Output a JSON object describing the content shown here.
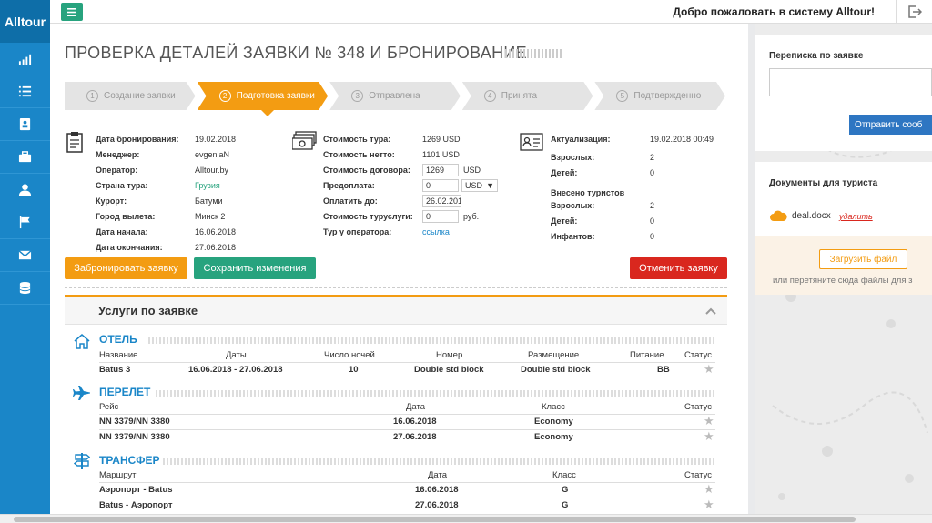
{
  "app": {
    "logo": "Alltour",
    "welcome": "Добро пожаловать в систему Alltour!"
  },
  "nav_icons": [
    "signal-icon",
    "list-icon",
    "contacts-icon",
    "briefcase-icon",
    "user-icon",
    "flag-icon",
    "envelope-icon",
    "database-icon"
  ],
  "page": {
    "title": "ПРОВЕРКА ДЕТАЛЕЙ ЗАЯВКИ № 348 И БРОНИРОВАНИЕ"
  },
  "steps": [
    {
      "num": "1",
      "label": "Создание заявки"
    },
    {
      "num": "2",
      "label": "Подготовка заявки"
    },
    {
      "num": "3",
      "label": "Отправлена"
    },
    {
      "num": "4",
      "label": "Принята"
    },
    {
      "num": "5",
      "label": "Подтвержденно"
    }
  ],
  "booking": {
    "date_lbl": "Дата бронирования:",
    "date": "19.02.2018",
    "manager_lbl": "Менеджер:",
    "manager": "evgeniaN",
    "operator_lbl": "Оператор:",
    "operator": "Alltour.by",
    "country_lbl": "Страна тура:",
    "country": "Грузия",
    "resort_lbl": "Курорт:",
    "resort": "Батуми",
    "city_lbl": "Город вылета:",
    "city": "Минск 2",
    "start_lbl": "Дата начала:",
    "start": "16.06.2018",
    "end_lbl": "Дата окончания:",
    "end": "27.06.2018"
  },
  "cost": {
    "tour_lbl": "Стоимость тура:",
    "tour": "1269 USD",
    "net_lbl": "Стоимость нетто:",
    "net": "1101 USD",
    "contract_lbl": "Стоимость договора:",
    "contract": "1269",
    "contract_cur": "USD",
    "prepay_lbl": "Предоплата:",
    "prepay": "0",
    "prepay_cur": "USD",
    "payby_lbl": "Оплатить до:",
    "payby": "26.02.201",
    "service_lbl": "Стоимость туруслуги:",
    "service": "0",
    "service_cur": "руб.",
    "link_lbl": "Тур у оператора:",
    "link": "ссылка"
  },
  "status": {
    "actual_lbl": "Актуализация:",
    "actual": "19.02.2018 00:49",
    "adults_lbl": "Взрослых:",
    "adults": "2",
    "children_lbl": "Детей:",
    "children": "0",
    "entered_title": "Внесено туристов",
    "e_adults_lbl": "Взрослых:",
    "e_adults": "2",
    "e_children_lbl": "Детей:",
    "e_children": "0",
    "e_infants_lbl": "Инфантов:",
    "e_infants": "0"
  },
  "buttons": {
    "book": "Забронировать заявку",
    "save": "Сохранить изменения",
    "cancel": "Отменить заявку"
  },
  "services": {
    "title": "Услуги по заявке",
    "hotel": {
      "title": "ОТЕЛЬ",
      "headers": [
        "Название",
        "Даты",
        "Число ночей",
        "Номер",
        "Размещение",
        "Питание",
        "Статус"
      ],
      "rows": [
        [
          "Batus 3",
          "16.06.2018 - 27.06.2018",
          "10",
          "Double std block",
          "Double std block",
          "BB"
        ]
      ]
    },
    "flight": {
      "title": "ПЕРЕЛЕТ",
      "headers": [
        "Рейс",
        "Дата",
        "Класс",
        "Статус"
      ],
      "rows": [
        [
          "NN 3379/NN 3380",
          "16.06.2018",
          "Economy"
        ],
        [
          "NN 3379/NN 3380",
          "27.06.2018",
          "Economy"
        ]
      ]
    },
    "transfer": {
      "title": "ТРАНСФЕР",
      "headers": [
        "Маршрут",
        "Дата",
        "Класс",
        "Статус"
      ],
      "rows": [
        [
          "Аэропорт - Batus",
          "16.06.2018",
          "G"
        ],
        [
          "Batus - Аэропорт",
          "27.06.2018",
          "G"
        ]
      ]
    }
  },
  "correspondence": {
    "title": "Переписка по заявке",
    "send": "Отправить сооб"
  },
  "documents": {
    "title": "Документы для туриста",
    "file": "deal.docx",
    "delete": "удалить",
    "upload": "Загрузить файл",
    "drop": "или перетяните сюда файлы для з"
  },
  "colors": {
    "sidebar": "#1a86c8",
    "accent": "#f39c12",
    "green": "#27a37e",
    "red": "#d9271e"
  }
}
